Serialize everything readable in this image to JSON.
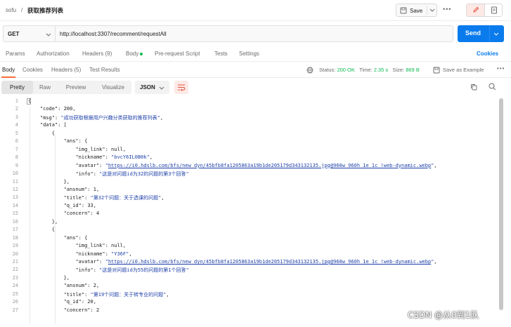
{
  "header": {
    "breadcrumb_parent": "sofu",
    "breadcrumb_sep": "/",
    "title": "获取推荐列表",
    "save_label": "Save",
    "more_label": "•••"
  },
  "request": {
    "method": "GET",
    "url": "http://localhost:3307/recomment/requestAll",
    "send_label": "Send"
  },
  "request_tabs": [
    "Params",
    "Authorization",
    "Headers (9)",
    "Body",
    "Pre-request Script",
    "Tests",
    "Settings"
  ],
  "cookies_link": "Cookies",
  "response": {
    "tabs": [
      "Body",
      "Cookies",
      "Headers (5)",
      "Test Results"
    ],
    "status_label": "Status:",
    "status_value": "200 OK",
    "time_label": "Time:",
    "time_value": "2.35 s",
    "size_label": "Size:",
    "size_value": "869 B",
    "save_example": "Save as Example",
    "more": "•••"
  },
  "viewer": {
    "format_tabs": [
      "Pretty",
      "Raw",
      "Preview",
      "Visualize"
    ],
    "active_format": "Pretty",
    "language": "JSON"
  },
  "code_lines": [
    {
      "n": "1",
      "t": "{"
    },
    {
      "n": "2",
      "t": "    \"code\": 200,"
    },
    {
      "n": "3",
      "t": "    \"msg\": \"成功获取根据用户兴趣分类获取的推荐列表\","
    },
    {
      "n": "4",
      "t": "    \"data\": ["
    },
    {
      "n": "5",
      "t": "        {"
    },
    {
      "n": "6",
      "t": "            \"ans\": {"
    },
    {
      "n": "7",
      "t": "                \"img_link\": null,"
    },
    {
      "n": "8",
      "t": "                \"nickname\": \"bvcY6IL0B0k\","
    },
    {
      "n": "9",
      "t": "                \"avatar\": \"https://i0.hdslb.com/bfs/new_dyn/45bfb8fa1205863a19b1de205179d343132135.jpg@960w_960h_1e_1c_!web-dynamic.webp\","
    },
    {
      "n": "10",
      "t": "                \"info\": \"这是对问题id为32的问题的第3个回答\""
    },
    {
      "n": "11",
      "t": "            },"
    },
    {
      "n": "12",
      "t": "            \"ansnum\": 1,"
    },
    {
      "n": "13",
      "t": "            \"title\": \"第32个问题：关于选课的问题\","
    },
    {
      "n": "14",
      "t": "            \"q_id\": 33,"
    },
    {
      "n": "15",
      "t": "            \"concern\": 4"
    },
    {
      "n": "16",
      "t": "        },"
    },
    {
      "n": "17",
      "t": "        {"
    },
    {
      "n": "18",
      "t": "            \"ans\": {"
    },
    {
      "n": "19",
      "t": "                \"img_link\": null,"
    },
    {
      "n": "20",
      "t": "                \"nickname\": \"Y36F\","
    },
    {
      "n": "21",
      "t": "                \"avatar\": \"https://i0.hdslb.com/bfs/new_dyn/45bfb8fa1205863a19b1de205179d343132135.jpg@960w_960h_1e_1c_!web-dynamic.webp\","
    },
    {
      "n": "22",
      "t": "                \"info\": \"这是对问题id为55的问题的第1个回答\""
    },
    {
      "n": "23",
      "t": "            },"
    },
    {
      "n": "24",
      "t": "            \"ansnum\": 2,"
    },
    {
      "n": "25",
      "t": "            \"title\": \"第19个问题：关于转专业的问题\","
    },
    {
      "n": "26",
      "t": "            \"q_id\": 20,"
    },
    {
      "n": "27",
      "t": "            \"concern\": 2"
    }
  ],
  "watermark": "CSDN @从0到1队",
  "colors": {
    "accent_orange": "#ff6c37",
    "send_blue": "#097bed",
    "status_green": "#0cbb52",
    "string_blue": "#1d3fa8"
  }
}
